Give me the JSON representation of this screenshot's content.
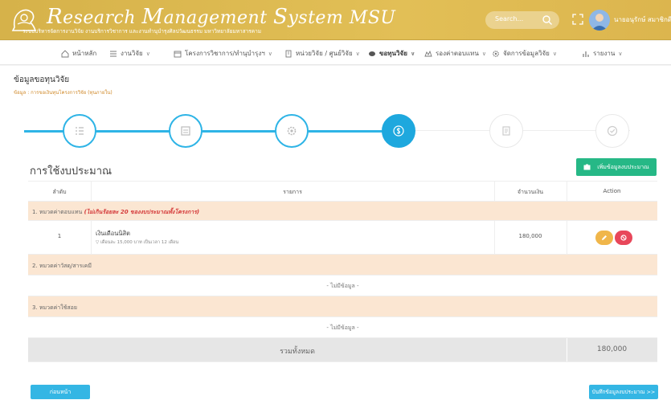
{
  "header": {
    "title_parts": [
      {
        "cap": "R",
        "rest": "esearch "
      },
      {
        "cap": "M",
        "rest": "anagement "
      },
      {
        "cap": "S",
        "rest": "ystem MSU"
      }
    ],
    "subtitle": "ระบบบริหารจัดการงานวิจัย งานบริการวิชาการ และงานทำนุบำรุงศิลปวัฒนธรรม มหาวิทยาลัยมหาสารคาม",
    "search_placeholder": "Search...",
    "user_name": "นายอนุรักษ์ สมาชิกดี",
    "colors": {
      "header": "#dcb54e",
      "primary": "#34b6e4",
      "success": "#26b886",
      "warning": "#f0b64a",
      "danger": "#e8475a",
      "category_bg": "#fbe6d2"
    }
  },
  "nav": {
    "items": [
      {
        "label": "หน้าหลัก",
        "icon": "home-icon",
        "dropdown": false
      },
      {
        "label": "งานวิจัย",
        "icon": "list-icon",
        "dropdown": true
      },
      {
        "label": "โครงการวิชาการ/ทำนุบำรุงฯ",
        "icon": "calendar-icon",
        "dropdown": true
      },
      {
        "label": "หน่วยวิจัย / ศูนย์วิจัย",
        "icon": "building-icon",
        "dropdown": true
      },
      {
        "label": "ขอทุนวิจัย",
        "icon": "coin-icon",
        "dropdown": true,
        "active": true
      },
      {
        "label": "รองค่าตอบแทน",
        "icon": "award-icon",
        "dropdown": true
      },
      {
        "label": "จัดการข้อมูลวิจัย",
        "icon": "gear-icon",
        "dropdown": true
      },
      {
        "label": "รายงาน",
        "icon": "chart-icon",
        "dropdown": true
      }
    ]
  },
  "page": {
    "title": "ข้อมูลขอทุนวิจัย",
    "breadcrumb": "ข้อมูล : การขอเงินทุนโครงการวิจัย (ทุนภายใน)"
  },
  "stepper": {
    "steps": [
      {
        "icon": "list-icon",
        "state": "done"
      },
      {
        "icon": "file-icon",
        "state": "done"
      },
      {
        "icon": "gear-icon",
        "state": "done"
      },
      {
        "icon": "dollar-icon",
        "state": "active"
      },
      {
        "icon": "document-icon",
        "state": "pending"
      },
      {
        "icon": "check-icon",
        "state": "pending"
      }
    ]
  },
  "budget": {
    "section_title": "การใช้งบประมาณ",
    "add_button_label": "เพิ่มข้อมูลงบประมาณ",
    "columns": [
      "ลำดับ",
      "รายการ",
      "จำนวนเงิน",
      "Action"
    ],
    "categories": [
      {
        "title": "1. หมวดค่าตอบแทน",
        "note": "(ไม่เกินร้อยละ 20 ของงบประมาณทั้งโครงการ)"
      },
      {
        "title": "2. หมวดค่าวัสดุ/สารเคมี",
        "note": ""
      },
      {
        "title": "3. หมวดค่าใช้สอย",
        "note": ""
      }
    ],
    "items": [
      {
        "no": "1",
        "name": "เงินเดือนนิสิต",
        "detail": "▽ เดือนละ 15,000 บาท เป็นเวลา 12 เดือน",
        "amount": "180,000"
      }
    ],
    "empty_text": "- ไม่มีข้อมูล -",
    "total_label": "รวมทั้งหมด",
    "total_value": "180,000"
  },
  "footer": {
    "back_label": "ก่อนหน้า",
    "save_label": "บันทึกข้อมูลงบประมาณ >>"
  }
}
